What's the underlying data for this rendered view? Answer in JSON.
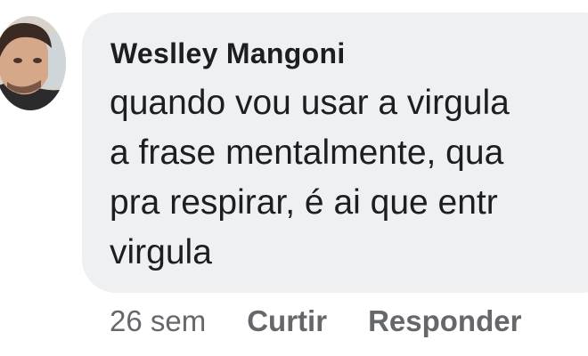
{
  "comment": {
    "author": "Weslley Mangoni",
    "text_lines": [
      "quando vou usar a virgula",
      "a frase mentalmente, qua",
      "pra respirar, é ai que entr",
      "virgula"
    ],
    "time": "26 sem",
    "like_label": "Curtir",
    "reply_label": "Responder"
  }
}
